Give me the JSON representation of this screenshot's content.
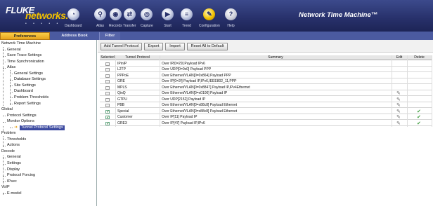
{
  "header": {
    "logo_top": "FLUKE",
    "logo_bottom": "networks.",
    "logo_dots": "• • • • •",
    "app_title": "Network Time Machine™",
    "toolbar": [
      {
        "label": "Dashboard",
        "icon": "dashboard-icon"
      },
      {
        "label": "Atlas",
        "icon": "atlas-icon"
      },
      {
        "label": "Records",
        "icon": "records-icon"
      },
      {
        "label": "Transfer",
        "icon": "transfer-icon"
      },
      {
        "label": "Capture",
        "icon": "capture-icon"
      },
      {
        "label": "Start",
        "icon": "start-icon"
      },
      {
        "label": "Trend",
        "icon": "trend-icon"
      },
      {
        "label": "Configuration",
        "icon": "configuration-icon"
      },
      {
        "label": "Help",
        "icon": "help-icon"
      }
    ]
  },
  "tabs": {
    "preferences": "Preferences",
    "address_book": "Address Book",
    "filter": "Filter"
  },
  "sidebar": {
    "items": [
      "Network Time Machine",
      "General",
      "Save Trace Settings",
      "Time Synchronization",
      "Atlas",
      "General Settings",
      "Database Settings",
      "Site Settings",
      "Dashboard",
      "Problem Thresholds",
      "Report Settings",
      "Global",
      "Protocol Settings",
      "Monitor Options",
      "Tunnel Protocol Settings",
      "Problem",
      "Thresholds",
      "Actions",
      "Decode",
      "General",
      "Settings",
      "Display",
      "Protocol Forcing",
      "IPsec",
      "VoIP",
      "E-model"
    ],
    "selected": "Tunnel Protocol Settings"
  },
  "toolbar": {
    "add": "Add Tunnel Protocol",
    "export": "Export",
    "import": "Import",
    "reset": "Reset All to Default"
  },
  "table": {
    "headers": {
      "selected": "Selected",
      "protocol": "Tunnel Protocol",
      "summary": "Summary",
      "edit": "Edit",
      "delete": "Delete"
    },
    "rows": [
      {
        "checked": false,
        "protocol": "IPinIP",
        "summary": "Over IP[0=29] Payload IPv6",
        "edit": false,
        "delete": false
      },
      {
        "checked": false,
        "protocol": "L2TP",
        "summary": "Over UDP[0=0x0] Payload PPP",
        "edit": false,
        "delete": false
      },
      {
        "checked": false,
        "protocol": "PPPoE",
        "summary": "Over Ethernet/VLAN[0=0x864] Payload PPP",
        "edit": false,
        "delete": false
      },
      {
        "checked": false,
        "protocol": "GRE",
        "summary": "Over IP[0=2f] Payload IP,IPv6,IEEE802_11,PPP",
        "edit": false,
        "delete": false
      },
      {
        "checked": false,
        "protocol": "MPLS",
        "summary": "Over Ethernet/VLAN[0=0x8847] Payload IP,IPv4Ethernet",
        "edit": false,
        "delete": false
      },
      {
        "checked": false,
        "protocol": "QinQ",
        "summary": "Over Ethernet/VLAN[0=x0100] Payload IP",
        "edit": true,
        "delete": false
      },
      {
        "checked": false,
        "protocol": "GTPU",
        "summary": "Over UDP[2152] Payload IP",
        "edit": true,
        "delete": false
      },
      {
        "checked": false,
        "protocol": "PBB",
        "summary": "Over Ethernet/VLAN[0=x88c8] Payload Ethernet",
        "edit": true,
        "delete": false
      },
      {
        "checked": true,
        "protocol": "Special",
        "summary": "Over Ethernet/VLAN[0=x88c8] Payload Ethernet",
        "edit": true,
        "delete": true
      },
      {
        "checked": true,
        "protocol": "Customer",
        "summary": "Over IP[11] Payload IP",
        "edit": true,
        "delete": true
      },
      {
        "checked": true,
        "protocol": "GRE3",
        "summary": "Over IP[47] Payload IP,IPv6",
        "edit": true,
        "delete": true
      }
    ]
  },
  "colors": {
    "header_bg": "#27306a",
    "accent": "#e6a31d",
    "logo_yellow": "#f2c100"
  }
}
